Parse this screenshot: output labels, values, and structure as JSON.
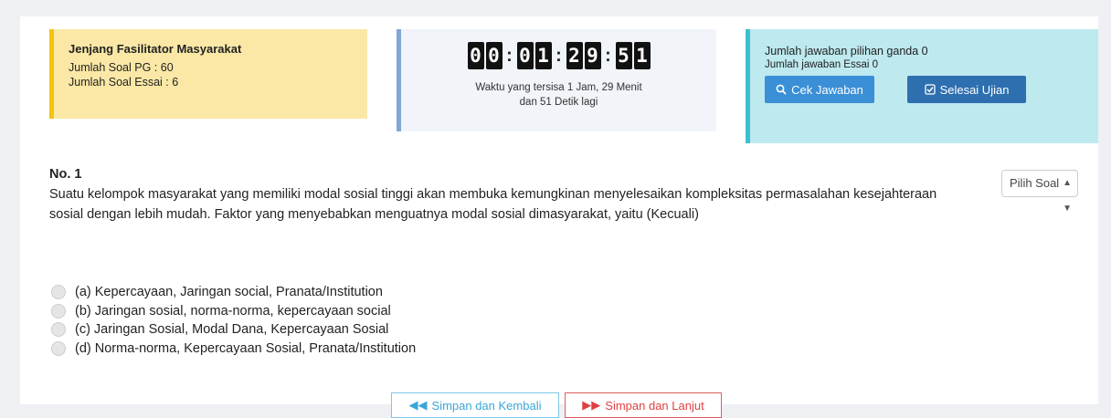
{
  "level": {
    "title": "Jenjang Fasilitator Masyarakat",
    "pg_count": "Jumlah Soal PG : 60",
    "essay_count": "Jumlah Soal Essai : 6"
  },
  "timer": {
    "d1": "0",
    "d2": "0",
    "d3": "0",
    "d4": "1",
    "d5": "2",
    "d6": "9",
    "d7": "5",
    "d8": "1",
    "colon": ":",
    "remaining_text": "Waktu yang tersisa 1 Jam, 29 Menit dan 51 Detik lagi"
  },
  "answers": {
    "choice_count": "Jumlah jawaban pilihan ganda 0",
    "essay_count": "Jumlah jawaban Essai 0",
    "check_label": "Cek Jawaban",
    "finish_label": "Selesai Ujian"
  },
  "question": {
    "number": "No. 1",
    "text": "Suatu kelompok masyarakat yang memiliki modal sosial tinggi akan membuka kemungkinan menyelesaikan kompleksitas permasalahan kesejahteraan sosial dengan lebih mudah. Faktor yang menyebabkan menguatnya modal sosial dimasyarakat, yaitu (Kecuali)",
    "select_label": "Pilih Soal",
    "options": [
      "(a) Kepercayaan, Jaringan social, Pranata/Institution",
      "(b) Jaringan sosial, norma-norma, kepercayaan social",
      "(c) Jaringan Sosial, Modal Dana, Kepercayaan Sosial",
      "(d) Norma-norma, Kepercayaan Sosial, Pranata/Institution"
    ]
  },
  "nav": {
    "back_label": "Simpan dan Kembali",
    "next_label": "Simpan dan Lanjut"
  },
  "icons": {
    "check": "search-icon",
    "finish": "check-square-icon",
    "back": "double-chevron-left-icon",
    "next": "double-chevron-right-icon"
  }
}
